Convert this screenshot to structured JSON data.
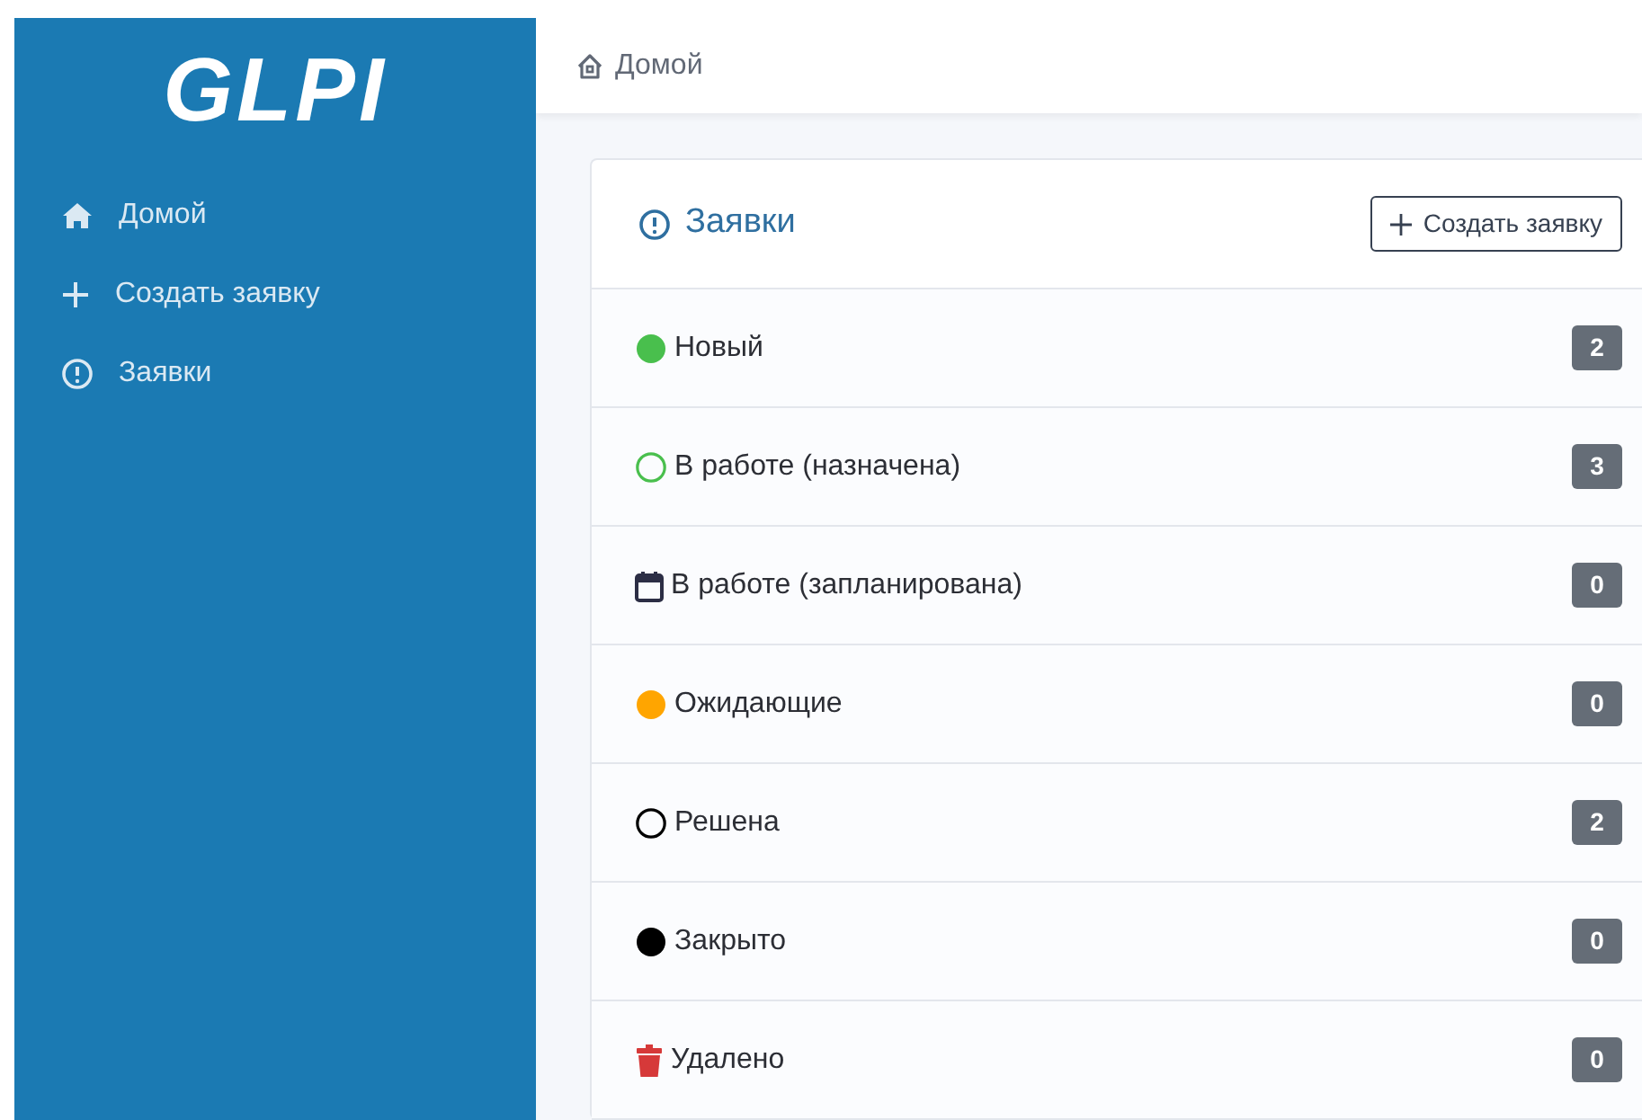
{
  "sidebar": {
    "logo": "GLPI",
    "items": [
      {
        "label": "Домой",
        "kind": "home"
      },
      {
        "label": "Создать заявку",
        "kind": "plus"
      },
      {
        "label": "Заявки",
        "kind": "alert"
      }
    ]
  },
  "breadcrumb": {
    "label": "Домой"
  },
  "card": {
    "title": "Заявки",
    "button": "Создать заявку",
    "rows": [
      {
        "label": "Новый",
        "kind": "dot",
        "color": "#49bf4d",
        "count": "2"
      },
      {
        "label": "В работе (назначена)",
        "kind": "ring",
        "color": "#49bf4d",
        "count": "3"
      },
      {
        "label": "В работе (запланирована)",
        "kind": "calendar",
        "color": "#2c2e45",
        "count": "0"
      },
      {
        "label": "Ожидающие",
        "kind": "dot",
        "color": "#ffa500",
        "count": "0"
      },
      {
        "label": "Решена",
        "kind": "ring",
        "color": "#000000",
        "count": "2"
      },
      {
        "label": "Закрыто",
        "kind": "dot",
        "color": "#000000",
        "count": "0"
      },
      {
        "label": "Удалено",
        "kind": "trash",
        "color": "#d63939",
        "count": "0"
      }
    ]
  }
}
